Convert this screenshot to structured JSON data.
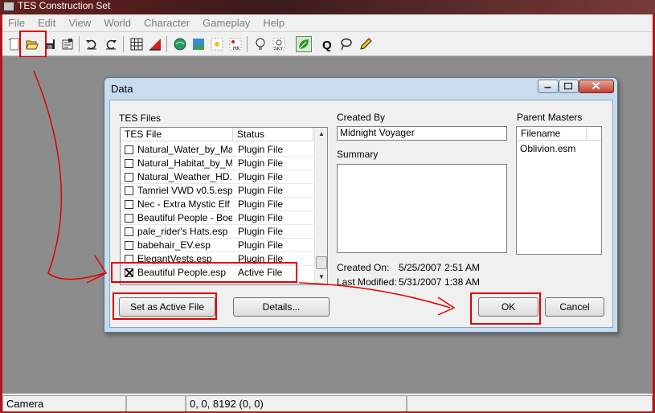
{
  "app": {
    "title": "TES Construction Set"
  },
  "menu": [
    "File",
    "Edit",
    "View",
    "World",
    "Character",
    "Gameplay",
    "Help"
  ],
  "toolbar": {
    "icons": [
      "new-icon",
      "open-icon",
      "save-icon",
      "preferences-icon",
      "undo-icon",
      "redo-icon",
      "grid-icon",
      "angle-snap-icon",
      "landscape-icon",
      "image-icon",
      "light-icon",
      "havok-icon",
      "bulb-icon",
      "sky-icon",
      "leaf-icon",
      "quest-icon",
      "lasso-icon",
      "pencil-icon"
    ],
    "havok_label": "HK",
    "sky_label": "SKY",
    "quest_label": "Q"
  },
  "status": {
    "mode": "Camera",
    "coords": "0, 0, 8192 (0, 0)"
  },
  "dialog": {
    "title": "Data",
    "tes_files_label": "TES Files",
    "columns": [
      "TES File",
      "Status"
    ],
    "files": [
      {
        "name": "Natural_Water_by_Ma...",
        "status": "Plugin File",
        "checked": false
      },
      {
        "name": "Natural_Habitat_by_M...",
        "status": "Plugin File",
        "checked": false
      },
      {
        "name": "Natural_Weather_HD...",
        "status": "Plugin File",
        "checked": false
      },
      {
        "name": "Tamriel VWD v0.5.esp",
        "status": "Plugin File",
        "checked": false
      },
      {
        "name": "Nec - Extra Mystic Elf ...",
        "status": "Plugin File",
        "checked": false
      },
      {
        "name": "Beautiful People - Boet...",
        "status": "Plugin File",
        "checked": false
      },
      {
        "name": "pale_rider's Hats.esp",
        "status": "Plugin File",
        "checked": false
      },
      {
        "name": "babehair_EV.esp",
        "status": "Plugin File",
        "checked": false
      },
      {
        "name": "ElegantVests.esp",
        "status": "Plugin File",
        "checked": false
      },
      {
        "name": "Beautiful People.esp",
        "status": "Active File",
        "checked": true
      }
    ],
    "created_by_label": "Created By",
    "created_by_value": "Midnight Voyager",
    "summary_label": "Summary",
    "summary_value": "",
    "created_on_label": "Created On:",
    "created_on_date": "5/25/2007",
    "created_on_time": "2:51 AM",
    "last_modified_label": "Last Modified:",
    "last_modified_date": "5/31/2007",
    "last_modified_time": "1:38 AM",
    "parent_masters_label": "Parent Masters",
    "masters_column": "Filename",
    "masters": [
      "Oblivion.esm"
    ],
    "set_active_label": "Set as Active File",
    "details_label": "Details...",
    "ok_label": "OK",
    "cancel_label": "Cancel"
  },
  "colors": {
    "annotation_red": "#e00000",
    "dialog_frame": "#c7dcee",
    "workspace": "#8c8c8c"
  }
}
